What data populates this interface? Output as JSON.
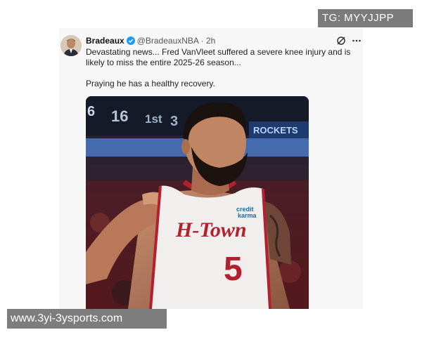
{
  "post": {
    "author_name": "Bradeaux",
    "handle": "@BradeauxNBA",
    "separator": "·",
    "time": "2h",
    "body_line1": "Devastating news... Fred VanVleet suffered a severe knee injury and is likely to miss the entire 2025-26 season...",
    "body_line2": "Praying he has a healthy recovery.",
    "icons": {
      "verified": "verified-badge-icon",
      "grok": "grok-icon",
      "more": "more-icon"
    }
  },
  "media": {
    "scoreboard_digit1": "6",
    "scoreboard_digit2": "16",
    "scoreboard_text1": "1st",
    "scoreboard_digit3": "3",
    "scoreboard_brand": "ROCKETS",
    "jersey_wordmark": "H-Town",
    "jersey_sponsor_line1": "credit",
    "jersey_sponsor_line2": "karma",
    "jersey_number": "5"
  },
  "watermarks": {
    "top": "TG: MYYJJPP",
    "bottom": "www.3yi-3ysports.com"
  },
  "colors": {
    "verified_blue": "#1d9bf0",
    "jersey_red": "#b3202e",
    "card_background": "#f7f7f7",
    "watermark_gray": "#7b7b7b"
  }
}
